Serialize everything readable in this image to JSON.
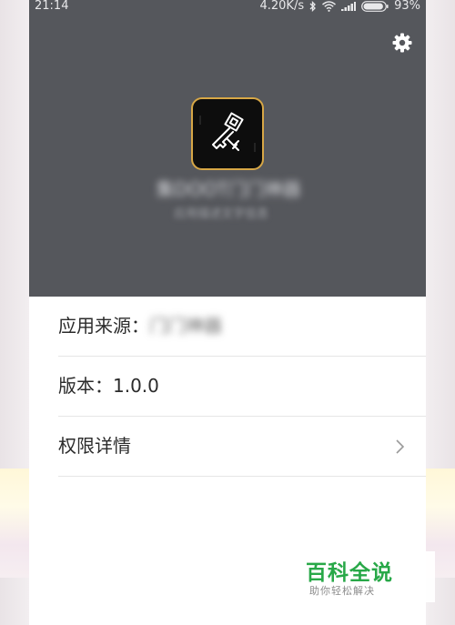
{
  "status_bar": {
    "time": "21:14",
    "network_speed": "4.20K/s",
    "battery_percent": "93%",
    "battery_level": 0.93,
    "icons": [
      "bluetooth-icon",
      "wifi-icon",
      "signal-icon",
      "battery-icon"
    ]
  },
  "header": {
    "app_name": "集DOOT门门神器",
    "app_description": "应用描述文字信息"
  },
  "info": {
    "source_label": "应用来源：",
    "source_value": "门门神器",
    "version_label": "版本：",
    "version_value": "1.0.0",
    "permissions_label": "权限详情"
  },
  "watermark": {
    "title": "百科全说",
    "subtitle": "助你轻松解决"
  },
  "colors": {
    "header_bg": "#55575c",
    "icon_border": "#d7a746",
    "watermark_green": "#28a848"
  }
}
